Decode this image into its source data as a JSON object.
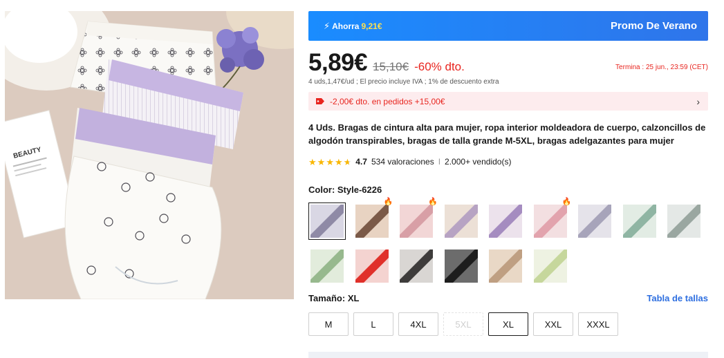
{
  "promo": {
    "bolt_icon": "lightning-icon",
    "save_prefix": "Ahorra",
    "save_amount": "9,21€",
    "title": "Promo De Verano"
  },
  "price": {
    "current": "5,89€",
    "original": "15,10€",
    "discount": "-60% dto.",
    "deadline": "Termina :  25 jun., 23:59 (CET)",
    "unit_info": "4 uds,1,47€/ud ; El precio incluye IVA ; 1% de descuento extra"
  },
  "coupon": {
    "icon": "tag-icon",
    "text": "-2,00€ dto. en pedidos +15,00€",
    "arrow": "›"
  },
  "product": {
    "title": "4 Uds. Bragas de cintura alta para mujer, ropa interior moldeadora de cuerpo, calzoncillos de algodón transpirables, bragas de talla grande M-5XL, bragas adelgazantes para mujer"
  },
  "rating": {
    "stars": 4.7,
    "value": "4.7",
    "reviews": "534 valoraciones",
    "separator": "I",
    "sold": "2.000+ vendido(s)"
  },
  "color": {
    "label": "Color: Style-6226",
    "swatches": [
      {
        "a": "#d9d7e4",
        "b": "#8f8aa6",
        "selected": true,
        "hot": false
      },
      {
        "a": "#e8d3c2",
        "b": "#7b5a48",
        "selected": false,
        "hot": true
      },
      {
        "a": "#f2d6d6",
        "b": "#d89fa6",
        "selected": false,
        "hot": true
      },
      {
        "a": "#ece0d6",
        "b": "#b7a3c3",
        "selected": false,
        "hot": false
      },
      {
        "a": "#ece2ec",
        "b": "#a58cc0",
        "selected": false,
        "hot": false
      },
      {
        "a": "#f3dfe1",
        "b": "#e2a3ad",
        "selected": false,
        "hot": true
      },
      {
        "a": "#e5e3ea",
        "b": "#a7a4ba",
        "selected": false,
        "hot": false
      },
      {
        "a": "#e2ece4",
        "b": "#8fb5a3",
        "selected": false,
        "hot": false
      },
      {
        "a": "#e4e8e6",
        "b": "#9aa7a1",
        "selected": false,
        "hot": false
      },
      {
        "a": "#e2ecdc",
        "b": "#97b98e",
        "selected": false,
        "hot": false
      },
      {
        "a": "#f4d3d0",
        "b": "#e0302a",
        "selected": false,
        "hot": false
      },
      {
        "a": "#d9d6d3",
        "b": "#3e3c3b",
        "selected": false,
        "hot": false
      },
      {
        "a": "#6c6c6c",
        "b": "#1d1d1d",
        "selected": false,
        "hot": false
      },
      {
        "a": "#e9d8c6",
        "b": "#bf9f82",
        "selected": false,
        "hot": false
      },
      {
        "a": "#eef2e2",
        "b": "#c6d79c",
        "selected": false,
        "hot": false
      }
    ]
  },
  "size": {
    "label": "Tamaño: XL",
    "chart_link": "Tabla de tallas",
    "options": [
      {
        "label": "M",
        "state": "normal"
      },
      {
        "label": "L",
        "state": "normal"
      },
      {
        "label": "4XL",
        "state": "normal"
      },
      {
        "label": "5XL",
        "state": "disabled"
      },
      {
        "label": "XL",
        "state": "selected"
      },
      {
        "label": "XXL",
        "state": "normal"
      },
      {
        "label": "XXXL",
        "state": "normal"
      }
    ]
  },
  "image": {
    "booklet_text": "BEAUTY"
  }
}
